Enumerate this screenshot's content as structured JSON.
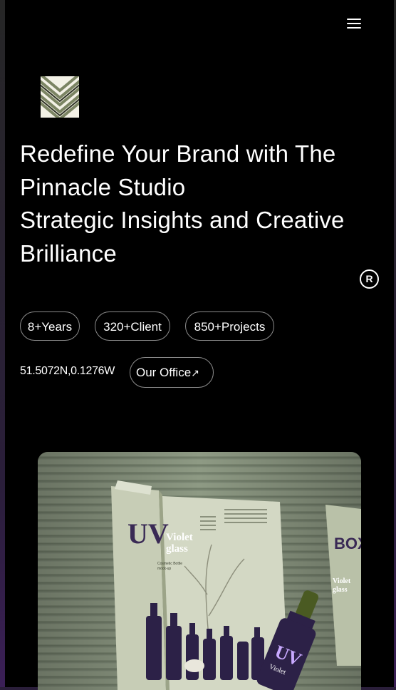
{
  "header": {
    "menu_icon": "hamburger-menu-icon"
  },
  "brand": {
    "logo_icon": "chevron-pattern-logo-icon"
  },
  "hero": {
    "headline_lines": [
      "Redefine Your Brand with The",
      "Pinnacle Studio",
      "Strategic Insights and Creative",
      "Brilliance"
    ],
    "registered_mark": "R"
  },
  "stats": [
    {
      "label": "8+Years"
    },
    {
      "label": "320+Client"
    },
    {
      "label": "850+Projects"
    }
  ],
  "location": {
    "coordinates": "51.5072N,0.1276W",
    "office_label": "Our Office",
    "office_arrow": "↗"
  },
  "showcase": {
    "brochure_letters": "UV",
    "brochure_title_1": "Violet",
    "brochure_title_2": "glass",
    "brochure_subtitle": "Cosmetic Bottle",
    "brochure_subtitle_2": "mock-up",
    "box_title": "BOX",
    "box_line_1": "Violet",
    "box_line_2": "glass",
    "dropper_label": "Violet"
  },
  "colors": {
    "background": "#000000",
    "text": "#ffffff",
    "pill_border": "#8c8c8c",
    "sage": "#8e9a84",
    "violet": "#3a2a55"
  }
}
